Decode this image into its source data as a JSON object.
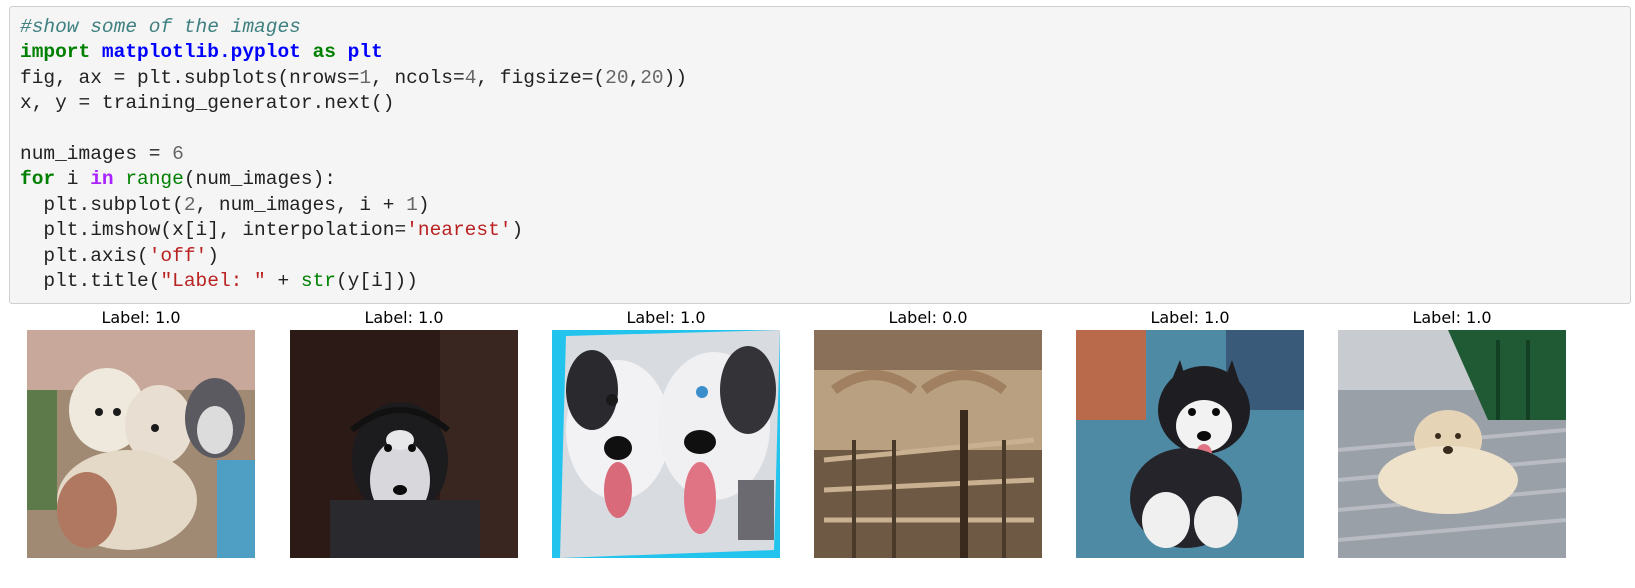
{
  "code_cell": {
    "lines": [
      [
        {
          "t": "#show some of the images",
          "c": "comment"
        }
      ],
      [
        {
          "t": "import",
          "c": "kw"
        },
        {
          "t": " ",
          "c": ""
        },
        {
          "t": "matplotlib.pyplot",
          "c": "module"
        },
        {
          "t": " ",
          "c": ""
        },
        {
          "t": "as",
          "c": "kw"
        },
        {
          "t": " ",
          "c": ""
        },
        {
          "t": "plt",
          "c": "module"
        }
      ],
      [
        {
          "t": "fig, ax = plt.subplots(nrows=",
          "c": ""
        },
        {
          "t": "1",
          "c": "num"
        },
        {
          "t": ", ncols=",
          "c": ""
        },
        {
          "t": "4",
          "c": "num"
        },
        {
          "t": ", figsize=(",
          "c": ""
        },
        {
          "t": "20",
          "c": "num"
        },
        {
          "t": ",",
          "c": ""
        },
        {
          "t": "20",
          "c": "num"
        },
        {
          "t": "))",
          "c": ""
        }
      ],
      [
        {
          "t": "x, y = training_generator.next()",
          "c": ""
        }
      ],
      [],
      [
        {
          "t": "num_images = ",
          "c": ""
        },
        {
          "t": "6",
          "c": "num"
        }
      ],
      [
        {
          "t": "for",
          "c": "kw"
        },
        {
          "t": " i ",
          "c": ""
        },
        {
          "t": "in",
          "c": "opword"
        },
        {
          "t": " ",
          "c": ""
        },
        {
          "t": "range",
          "c": "builtin"
        },
        {
          "t": "(num_images):",
          "c": ""
        }
      ],
      [
        {
          "t": "  plt.subplot(",
          "c": ""
        },
        {
          "t": "2",
          "c": "num"
        },
        {
          "t": ", num_images, i + ",
          "c": ""
        },
        {
          "t": "1",
          "c": "num"
        },
        {
          "t": ")",
          "c": ""
        }
      ],
      [
        {
          "t": "  plt.imshow(x[i], interpolation=",
          "c": ""
        },
        {
          "t": "'nearest'",
          "c": "str"
        },
        {
          "t": ")",
          "c": ""
        }
      ],
      [
        {
          "t": "  plt.axis(",
          "c": ""
        },
        {
          "t": "'off'",
          "c": "str"
        },
        {
          "t": ")",
          "c": ""
        }
      ],
      [
        {
          "t": "  plt.title(",
          "c": ""
        },
        {
          "t": "\"Label: \"",
          "c": "str"
        },
        {
          "t": " + ",
          "c": ""
        },
        {
          "t": "str",
          "c": "builtin"
        },
        {
          "t": "(y[i]))",
          "c": ""
        }
      ]
    ]
  },
  "output": {
    "panels": [
      {
        "title": "Label: 1.0",
        "image": "husky-puppies-held-photo"
      },
      {
        "title": "Label: 1.0",
        "image": "husky-with-headphones-photo"
      },
      {
        "title": "Label: 1.0",
        "image": "two-huskies-closeup-photo"
      },
      {
        "title": "Label: 0.0",
        "image": "wooden-fence-room-photo"
      },
      {
        "title": "Label: 1.0",
        "image": "husky-puppy-sitting-photo"
      },
      {
        "title": "Label: 1.0",
        "image": "fluffy-puppy-lying-photo"
      }
    ]
  },
  "colors": {
    "cell_background": "#f5f5f5",
    "cell_border": "#cfcfcf",
    "comment": "#408080",
    "keyword": "#008000",
    "module": "#0000ff",
    "number": "#666666",
    "string": "#ba2121",
    "operator_word": "#aa22ff"
  }
}
